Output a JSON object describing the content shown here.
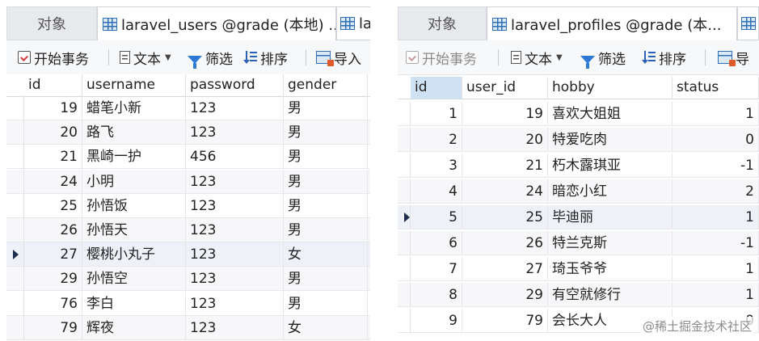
{
  "left": {
    "tabs": {
      "objects": "对象",
      "current": "laravel_users @grade (本地) ...",
      "next": "la"
    },
    "toolbar": {
      "begin_transaction": "开始事务",
      "text": "文本",
      "filter": "筛选",
      "sort": "排序",
      "import": "导入"
    },
    "columns": [
      "id",
      "username",
      "password",
      "gender"
    ],
    "current_row_index": 6,
    "rows": [
      [
        "19",
        "蜡笔小新",
        "123",
        "男"
      ],
      [
        "20",
        "路飞",
        "123",
        "男"
      ],
      [
        "21",
        "黑崎一护",
        "456",
        "男"
      ],
      [
        "24",
        "小明",
        "123",
        "男"
      ],
      [
        "25",
        "孙悟饭",
        "123",
        "男"
      ],
      [
        "26",
        "孙悟天",
        "123",
        "男"
      ],
      [
        "27",
        "樱桃小丸子",
        "123",
        "女"
      ],
      [
        "29",
        "孙悟空",
        "123",
        "男"
      ],
      [
        "76",
        "李白",
        "123",
        "男"
      ],
      [
        "79",
        "辉夜",
        "123",
        "女"
      ]
    ]
  },
  "right": {
    "tabs": {
      "objects": "对象",
      "current": "laravel_profiles @grade (本..."
    },
    "toolbar": {
      "begin_transaction": "开始事务",
      "text": "文本",
      "filter": "筛选",
      "sort": "排序",
      "import": "导"
    },
    "columns": [
      "id",
      "user_id",
      "hobby",
      "status"
    ],
    "current_row_index": 4,
    "rows": [
      [
        "1",
        "19",
        "喜欢大姐姐",
        "1"
      ],
      [
        "2",
        "20",
        "特爱吃肉",
        "0"
      ],
      [
        "3",
        "21",
        "朽木露琪亚",
        "-1"
      ],
      [
        "4",
        "24",
        "暗恋小红",
        "2"
      ],
      [
        "5",
        "25",
        "毕迪丽",
        "1"
      ],
      [
        "6",
        "26",
        "特兰克斯",
        "-1"
      ],
      [
        "7",
        "27",
        "琦玉爷爷",
        "1"
      ],
      [
        "8",
        "29",
        "有空就修行",
        "1"
      ],
      [
        "9",
        "79",
        "会长大人",
        "0"
      ]
    ]
  },
  "watermark": "@稀土掘金技术社区",
  "colors": {
    "accent_blue": "#2f6fb3",
    "selected_header": "#cfe2f5",
    "current_row_marker": "#1f2d4d"
  }
}
